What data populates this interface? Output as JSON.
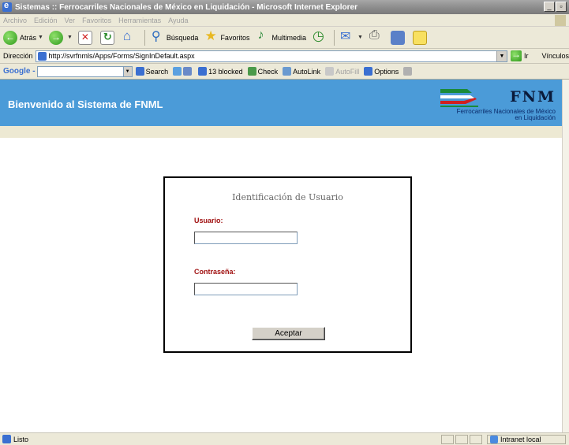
{
  "window": {
    "title": "Sistemas :: Ferrocarriles Nacionales de México en Liquidación - Microsoft Internet Explorer",
    "minimize": "_",
    "maximize": "▫"
  },
  "menu": [
    "Archivo",
    "Edición",
    "Ver",
    "Favoritos",
    "Herramientas",
    "Ayuda"
  ],
  "toolbar": {
    "back": "Atrás",
    "search": "Búsqueda",
    "favorites": "Favoritos",
    "media": "Multimedia"
  },
  "address": {
    "label": "Dirección",
    "url": "http://svrfnmls/Apps/Forms/SignInDefault.aspx",
    "go": "Ir",
    "links": "Vínculos"
  },
  "google_toolbar": {
    "logo": "Google -",
    "search": "Search",
    "blocked": "13 blocked",
    "check": "Check",
    "autolink": "AutoLink",
    "autofill": "AutoFill",
    "options": "Options"
  },
  "page": {
    "header_title": "Bienvenido al Sistema de FNML",
    "logo_text": "FNM",
    "logo_sub1": "Ferrocarriles Nacionales de México",
    "logo_sub2": "en Liquidación",
    "login": {
      "title": "Identificación de Usuario",
      "user_label": "Usuario:",
      "user_value": "",
      "pass_label": "Contraseña:",
      "pass_value": "",
      "accept": "Aceptar"
    }
  },
  "status": {
    "text": "Listo",
    "zone": "Intranet local"
  },
  "colors": {
    "header_blue": "#4b9bd8",
    "sub_band": "#ede9d3",
    "label_red": "#a01010",
    "logo_red": "#d02020",
    "logo_green": "#1a8a3a"
  }
}
